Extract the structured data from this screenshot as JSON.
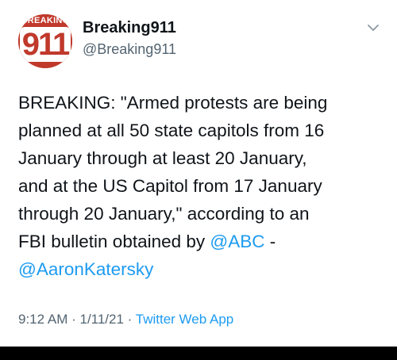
{
  "profile": {
    "avatar_band": "BREAKING",
    "avatar_number": "911",
    "display_name": "Breaking911",
    "handle": "@Breaking911"
  },
  "tweet": {
    "text_main": "BREAKING: \"Armed protests are being\nplanned at all 50 state capitols from 16\nJanuary through at least 20 January,\nand at the US Capitol from 17 January\nthrough 20 January,\" according to an\nFBI bulletin obtained by ",
    "mention_1": "@ABC",
    "separator": "  -\n",
    "mention_2": "@AaronKatersky"
  },
  "meta": {
    "time": "9:12 AM",
    "dot1": " · ",
    "date": "1/11/21",
    "dot2": " · ",
    "source": "Twitter Web App"
  },
  "icons": {
    "menu": "chevron-down-icon"
  },
  "colors": {
    "link": "#1d9bf0",
    "secondary": "#536471",
    "brand_red": "#c0392b"
  }
}
